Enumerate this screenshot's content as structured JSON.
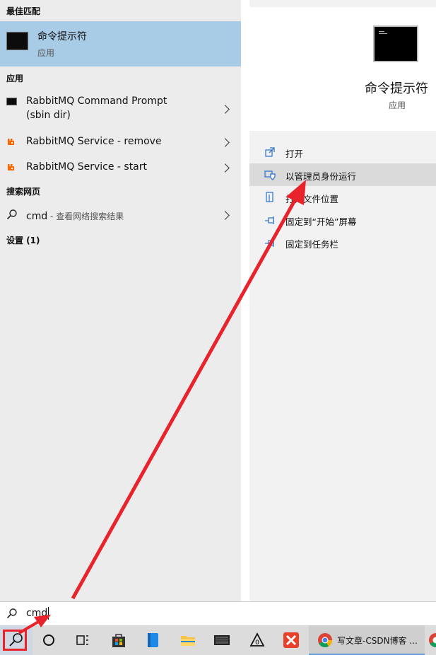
{
  "left": {
    "best_match_header": "最佳匹配",
    "best_match": {
      "title": "命令提示符",
      "subtitle": "应用"
    },
    "apps_header": "应用",
    "apps": [
      {
        "line1": "RabbitMQ Command Prompt",
        "line2": "(sbin dir)",
        "icon": "cmd-icon"
      },
      {
        "line1": "RabbitMQ Service - remove",
        "icon": "rabbitmq-icon"
      },
      {
        "line1": "RabbitMQ Service - start",
        "icon": "rabbitmq-icon"
      }
    ],
    "web_header": "搜索网页",
    "web_item": {
      "query": "cmd",
      "suffix": " - 查看网络搜索结果"
    },
    "settings_header": "设置 (1)"
  },
  "right": {
    "app_title": "命令提示符",
    "app_type": "应用",
    "actions": [
      "打开",
      "以管理员身份运行",
      "打开文件位置",
      "固定到“开始”屏幕",
      "固定到任务栏"
    ]
  },
  "search": {
    "value": "cmd"
  },
  "taskbar": {
    "chrome_label": "写文章-CSDN博客 ..."
  },
  "colors": {
    "selection": "#a8cbe6",
    "hover_action": "#dadada",
    "annotation_red": "#e8232b",
    "rabbitmq_orange": "#ff6600"
  }
}
